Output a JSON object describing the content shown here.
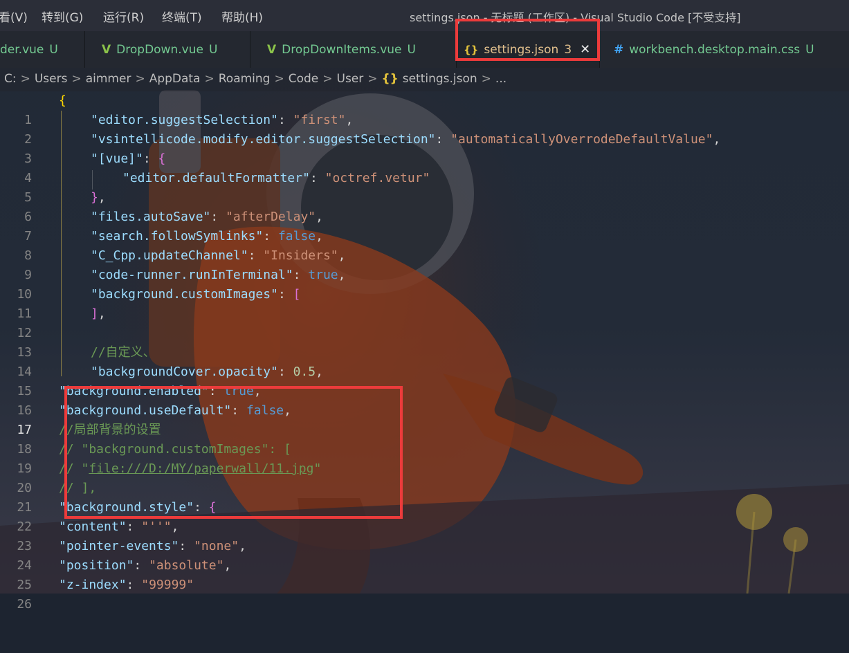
{
  "menu": {
    "items": [
      "看(V)",
      "转到(G)",
      "运行(R)",
      "终端(T)",
      "帮助(H)"
    ],
    "window_title": "settings.json - 无标题 (工作区) - Visual Studio Code [不受支持]"
  },
  "tabs": [
    {
      "icon": "",
      "label": "der.vue",
      "badge": "U"
    },
    {
      "icon": "V",
      "label": "DropDown.vue",
      "badge": "U"
    },
    {
      "icon": "V",
      "label": "DropDownItems.vue",
      "badge": "U"
    },
    {
      "icon": "{}",
      "label": "settings.json",
      "badge": "3",
      "close": "✕"
    },
    {
      "icon": "#",
      "label": "workbench.desktop.main.css",
      "badge": "U"
    }
  ],
  "breadcrumb": {
    "items": [
      "C:",
      "Users",
      "aimmer",
      "AppData",
      "Roaming",
      "Code",
      "User",
      "settings.json",
      "..."
    ],
    "separator": ">",
    "file_icon": "{}"
  },
  "editor": {
    "line_numbers": [
      "1",
      "2",
      "3",
      "4",
      "5",
      "6",
      "7",
      "8",
      "9",
      "10",
      "11",
      "12",
      "13",
      "14",
      "15",
      "16",
      "17",
      "18",
      "19",
      "20",
      "21",
      "22",
      "23",
      "24",
      "25",
      "26"
    ],
    "current_line": "17",
    "lines": {
      "l1": {
        "open": "{"
      },
      "l2": {
        "key": "\"editor.suggestSelection\"",
        "colon": ": ",
        "value": "\"first\"",
        "comma": ","
      },
      "l3": {
        "key": "\"vsintellicode.modify.editor.suggestSelection\"",
        "colon": ": ",
        "value": "\"automaticallyOverrodeDefaultValue\"",
        "comma": ","
      },
      "l4": {
        "key": "\"[vue]\"",
        "colon": ": ",
        "value": "{"
      },
      "l5": {
        "key": "\"editor.defaultFormatter\"",
        "colon": ": ",
        "value": "\"octref.vetur\""
      },
      "l6": {
        "close": "}",
        "comma": ","
      },
      "l7": {
        "key": "\"files.autoSave\"",
        "colon": ": ",
        "value": "\"afterDelay\"",
        "comma": ","
      },
      "l8": {
        "key": "\"search.followSymlinks\"",
        "colon": ": ",
        "value": "false",
        "comma": ","
      },
      "l9": {
        "key": "\"C_Cpp.updateChannel\"",
        "colon": ": ",
        "value": "\"Insiders\"",
        "comma": ","
      },
      "l10": {
        "key": "\"code-runner.runInTerminal\"",
        "colon": ": ",
        "value": "true",
        "comma": ","
      },
      "l11": {
        "key": "\"background.customImages\"",
        "colon": ": ",
        "value": "["
      },
      "l12": {
        "close": "]",
        "comma": ","
      },
      "l14": {
        "comment": "//自定义、"
      },
      "l15": {
        "key": "\"backgroundCover.opacity\"",
        "colon": ": ",
        "value": "0.5",
        "comma": ","
      },
      "l16": {
        "key": "\"background.enabled\"",
        "colon": ": ",
        "value": "true",
        "comma": ","
      },
      "l17": {
        "key": "\"background.useDefault\"",
        "colon": ": ",
        "value": "false",
        "comma": ","
      },
      "l18": {
        "comment": "//局部背景的设置"
      },
      "l19": {
        "comment": "// \"background.customImages\": ["
      },
      "l20": {
        "comment_prefix": "// \"",
        "link": "file:///D:/MY/paperwall/11.jpg",
        "comment_suffix": "\""
      },
      "l21": {
        "comment": "// ],"
      },
      "l22": {
        "key": "\"background.style\"",
        "colon": ": ",
        "value": "{"
      },
      "l23": {
        "key": "\"content\"",
        "colon": ": ",
        "value": "\"''\"",
        "comma": ","
      },
      "l24": {
        "key": "\"pointer-events\"",
        "colon": ": ",
        "value": "\"none\"",
        "comma": ","
      },
      "l25": {
        "key": "\"position\"",
        "colon": ": ",
        "value": "\"absolute\"",
        "comma": ","
      },
      "l26": {
        "key": "\"z-index\"",
        "colon": ": ",
        "value": "\"99999\""
      }
    }
  },
  "colors": {
    "accent_red": "#ec3b3b",
    "untracked_green": "#73c991",
    "modified_yellow": "#e2c08d",
    "json_key": "#9cdcfe",
    "json_string": "#ce9178",
    "json_keyword": "#569cd6",
    "json_number": "#b5cea8",
    "comment": "#6a9955"
  }
}
